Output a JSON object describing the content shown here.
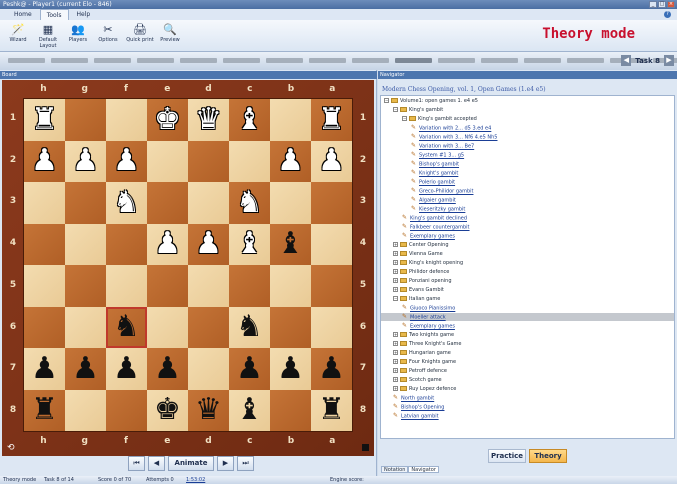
{
  "window": {
    "title": "Peshk@ - Player1 (current Elo - 846)",
    "controls": [
      "_",
      "□",
      "×"
    ]
  },
  "ribbon": {
    "tabs": [
      "Home",
      "Tools",
      "Help"
    ],
    "active_tab": "Tools",
    "buttons": [
      {
        "label": "Wizard",
        "icon": "wizard-icon",
        "glyph": "🪄"
      },
      {
        "label": "Default Layout",
        "icon": "layout-icon",
        "glyph": "▦"
      },
      {
        "label": "Players",
        "icon": "players-icon",
        "glyph": "👥"
      },
      {
        "label": "Options",
        "icon": "options-icon",
        "glyph": "✂"
      },
      {
        "label": "Quick print",
        "icon": "print-icon",
        "glyph": "🖨"
      },
      {
        "label": "Preview",
        "icon": "preview-icon",
        "glyph": "🔍"
      }
    ]
  },
  "mode_title": "Theory mode",
  "task_nav": {
    "label": "Task 8",
    "prev": "◀",
    "next": "▶",
    "progress_segments": 16,
    "current_segment": 9
  },
  "board_panel": {
    "title": "Board",
    "files": [
      "h",
      "g",
      "f",
      "e",
      "d",
      "c",
      "b",
      "a"
    ],
    "ranks": [
      "1",
      "2",
      "3",
      "4",
      "5",
      "6",
      "7",
      "8"
    ],
    "squares": [
      [
        "♜w",
        "",
        "",
        "♚w",
        "♛w",
        "♝w",
        "",
        "♜w"
      ],
      [
        "♟w",
        "♟w",
        "♟w",
        "",
        "",
        "",
        "♟w",
        "♟w"
      ],
      [
        "",
        "",
        "♞w",
        "",
        "",
        "♞w",
        "",
        ""
      ],
      [
        "",
        "",
        "",
        "♟w",
        "♟w",
        "♝w",
        "♝b",
        ""
      ],
      [
        "",
        "",
        "",
        "",
        "",
        "",
        "",
        ""
      ],
      [
        "",
        "",
        "♞b",
        "",
        "",
        "♞b",
        "",
        ""
      ],
      [
        "♟b",
        "♟b",
        "♟b",
        "♟b",
        "",
        "♟b",
        "♟b",
        "♟b"
      ],
      [
        "♜b",
        "",
        "",
        "♚b",
        "♛b",
        "♝b",
        "",
        "♜b"
      ]
    ],
    "highlight": {
      "row": 5,
      "col": 2
    }
  },
  "move_nav": {
    "first": "⏮",
    "prev": "◀",
    "animate": "Animate",
    "next": "▶",
    "last": "⏭"
  },
  "navigator": {
    "title": "Navigator",
    "book_title": "Modern Chess Opening, vol. 1, Open Games (1.e4 e5)",
    "tree": [
      {
        "level": 0,
        "kind": "folder",
        "exp": "−",
        "label": "Volume1: open games 1. e4 e5"
      },
      {
        "level": 1,
        "kind": "folder",
        "exp": "−",
        "label": "King's gambit"
      },
      {
        "level": 2,
        "kind": "folder",
        "exp": "−",
        "label": "King's gambit accepted"
      },
      {
        "level": 3,
        "kind": "link",
        "label": "Variation with 2... d5 3.ed e4"
      },
      {
        "level": 3,
        "kind": "link",
        "label": "Variation with 3... Nf6 4.e5 Nh5"
      },
      {
        "level": 3,
        "kind": "link",
        "label": "Variation with 3... Be7"
      },
      {
        "level": 3,
        "kind": "link",
        "label": "System #1 3... g5"
      },
      {
        "level": 3,
        "kind": "link",
        "label": "Bishop's gambit"
      },
      {
        "level": 3,
        "kind": "link",
        "label": "Knight's gambit"
      },
      {
        "level": 3,
        "kind": "link",
        "label": "Polerio gambit"
      },
      {
        "level": 3,
        "kind": "link",
        "label": "Greco-Philidor gambit"
      },
      {
        "level": 3,
        "kind": "link",
        "label": "Algaier gambit"
      },
      {
        "level": 3,
        "kind": "link",
        "label": "Kieseritzky gambit"
      },
      {
        "level": 2,
        "kind": "link",
        "label": "King's gambit declined"
      },
      {
        "level": 2,
        "kind": "link",
        "label": "Falkbeer countergambit"
      },
      {
        "level": 2,
        "kind": "link",
        "label": "Exemplary games"
      },
      {
        "level": 1,
        "kind": "folder",
        "exp": "+",
        "label": "Center Opening"
      },
      {
        "level": 1,
        "kind": "folder",
        "exp": "+",
        "label": "Vienna Game"
      },
      {
        "level": 1,
        "kind": "folder",
        "exp": "+",
        "label": "King's knight opening"
      },
      {
        "level": 1,
        "kind": "folder",
        "exp": "+",
        "label": "Philidor defence"
      },
      {
        "level": 1,
        "kind": "folder",
        "exp": "+",
        "label": "Ponziani opening"
      },
      {
        "level": 1,
        "kind": "folder",
        "exp": "+",
        "label": "Evans Gambit"
      },
      {
        "level": 1,
        "kind": "folder",
        "exp": "−",
        "label": "Italian game"
      },
      {
        "level": 2,
        "kind": "link",
        "label": "Giuoco Pianissimo"
      },
      {
        "level": 2,
        "kind": "link",
        "label": "Moeller attack",
        "selected": true
      },
      {
        "level": 2,
        "kind": "link",
        "label": "Exemplary games"
      },
      {
        "level": 1,
        "kind": "folder",
        "exp": "+",
        "label": "Two knights game"
      },
      {
        "level": 1,
        "kind": "folder",
        "exp": "+",
        "label": "Three Knight's Game"
      },
      {
        "level": 1,
        "kind": "folder",
        "exp": "+",
        "label": "Hungarian game"
      },
      {
        "level": 1,
        "kind": "folder",
        "exp": "+",
        "label": "Four Knights game"
      },
      {
        "level": 1,
        "kind": "folder",
        "exp": "+",
        "label": "Petroff defence"
      },
      {
        "level": 1,
        "kind": "folder",
        "exp": "+",
        "label": "Scotch game"
      },
      {
        "level": 1,
        "kind": "folder",
        "exp": "+",
        "label": "Ruy Lopez defence"
      },
      {
        "level": 1,
        "kind": "link",
        "label": "North gambit"
      },
      {
        "level": 1,
        "kind": "link",
        "label": "Bishop's Opening"
      },
      {
        "level": 1,
        "kind": "link",
        "label": "Latvian gambit"
      }
    ],
    "practice_label": "Practice",
    "theory_label": "Theory",
    "bottom_tabs": [
      "Notation",
      "Navigator"
    ]
  },
  "status": {
    "mode": "Theory mode",
    "task": "Task 8 of 14",
    "score": "Score 0 of 70",
    "attempts": "Attempts 0",
    "time": "1:53:02",
    "engine": "Engine score:"
  }
}
